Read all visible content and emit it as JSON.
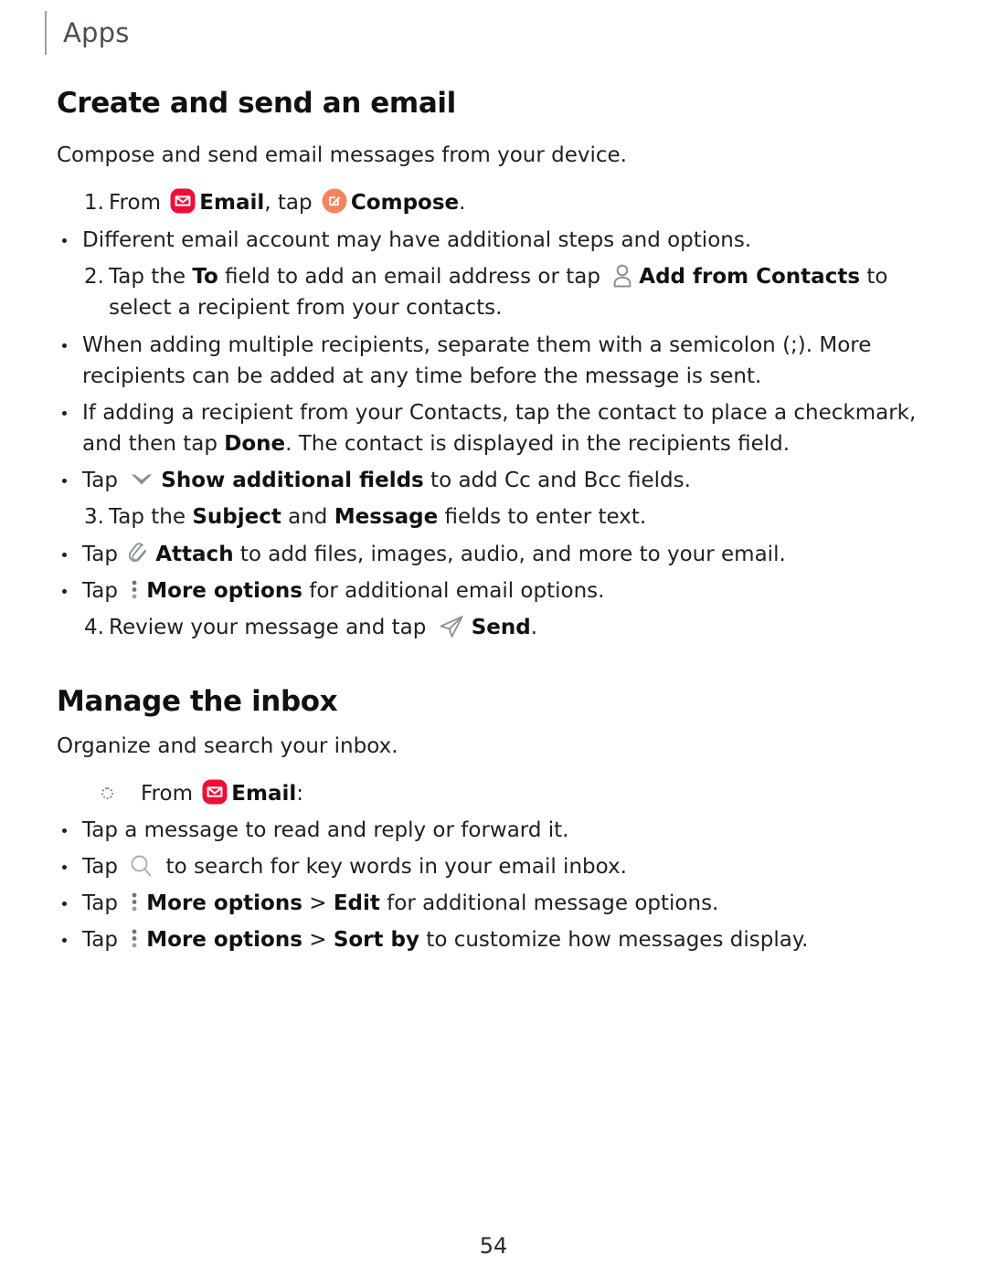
{
  "header": {
    "running_head": "Apps"
  },
  "footer": {
    "page_number": "54"
  },
  "colors": {
    "email_icon_red": "#EE0F38",
    "compose_icon_orange": "#F4845F",
    "gray_icon": "#8A9093",
    "header_rule": "#9AA0A3",
    "body_text": "#1F1F1F"
  },
  "sections": [
    {
      "id": "create-and-send-an-email",
      "title": "Create and send an email",
      "lead": "Compose and send email messages from your device.",
      "steps": [
        {
          "number": "1.",
          "parts": [
            {
              "type": "text",
              "value": "From "
            },
            {
              "type": "icon",
              "name": "email-icon"
            },
            {
              "type": "bold",
              "value": "Email"
            },
            {
              "type": "text",
              "value": ", tap "
            },
            {
              "type": "icon",
              "name": "compose-icon"
            },
            {
              "type": "bold",
              "value": "Compose"
            },
            {
              "type": "text",
              "value": "."
            }
          ],
          "bullets": [
            {
              "parts": [
                {
                  "type": "text",
                  "value": "Different email account may have additional steps and options."
                }
              ]
            }
          ]
        },
        {
          "number": "2.",
          "parts": [
            {
              "type": "text",
              "value": "Tap the "
            },
            {
              "type": "bold",
              "value": "To"
            },
            {
              "type": "text",
              "value": " field to add an email address or tap "
            },
            {
              "type": "icon",
              "name": "contacts-icon"
            },
            {
              "type": "bold",
              "value": "Add from Contacts"
            },
            {
              "type": "text",
              "value": " to select a recipient from your contacts."
            }
          ],
          "bullets": [
            {
              "parts": [
                {
                  "type": "text",
                  "value": "When adding multiple recipients, separate them with a semicolon (;). More recipients can be added at any time before the message is sent."
                }
              ]
            },
            {
              "parts": [
                {
                  "type": "text",
                  "value": "If adding a recipient from your Contacts, tap the contact to place a checkmark, and then tap "
                },
                {
                  "type": "bold",
                  "value": "Done"
                },
                {
                  "type": "text",
                  "value": ". The contact is displayed in the recipients field."
                }
              ]
            },
            {
              "parts": [
                {
                  "type": "text",
                  "value": "Tap "
                },
                {
                  "type": "icon",
                  "name": "chevron-down-icon"
                },
                {
                  "type": "bold",
                  "value": "Show additional fields"
                },
                {
                  "type": "text",
                  "value": " to add Cc and Bcc fields."
                }
              ]
            }
          ]
        },
        {
          "number": "3.",
          "parts": [
            {
              "type": "text",
              "value": "Tap the "
            },
            {
              "type": "bold",
              "value": "Subject"
            },
            {
              "type": "text",
              "value": " and "
            },
            {
              "type": "bold",
              "value": "Message"
            },
            {
              "type": "text",
              "value": " fields to enter text."
            }
          ],
          "bullets": [
            {
              "parts": [
                {
                  "type": "text",
                  "value": "Tap "
                },
                {
                  "type": "icon",
                  "name": "attach-icon"
                },
                {
                  "type": "bold",
                  "value": "Attach"
                },
                {
                  "type": "text",
                  "value": " to add files, images, audio, and more to your email."
                }
              ]
            },
            {
              "parts": [
                {
                  "type": "text",
                  "value": "Tap "
                },
                {
                  "type": "icon",
                  "name": "more-options-icon"
                },
                {
                  "type": "bold",
                  "value": "More options"
                },
                {
                  "type": "text",
                  "value": " for additional email options."
                }
              ]
            }
          ]
        },
        {
          "number": "4.",
          "parts": [
            {
              "type": "text",
              "value": "Review your message and tap "
            },
            {
              "type": "icon",
              "name": "send-icon"
            },
            {
              "type": "bold",
              "value": "Send"
            },
            {
              "type": "text",
              "value": "."
            }
          ],
          "bullets": []
        }
      ]
    },
    {
      "id": "manage-the-inbox",
      "title": "Manage the inbox",
      "lead": "Organize and search your inbox.",
      "dotted_item": {
        "parts": [
          {
            "type": "text",
            "value": "From "
          },
          {
            "type": "icon",
            "name": "email-icon"
          },
          {
            "type": "bold",
            "value": "Email"
          },
          {
            "type": "text",
            "value": ":"
          }
        ]
      },
      "bullets": [
        {
          "parts": [
            {
              "type": "text",
              "value": "Tap a message to read and reply or forward it."
            }
          ]
        },
        {
          "parts": [
            {
              "type": "text",
              "value": "Tap "
            },
            {
              "type": "icon",
              "name": "search-icon"
            },
            {
              "type": "text",
              "value": " to search for key words in your email inbox."
            }
          ]
        },
        {
          "parts": [
            {
              "type": "text",
              "value": "Tap "
            },
            {
              "type": "icon",
              "name": "more-options-icon"
            },
            {
              "type": "bold",
              "value": "More options"
            },
            {
              "type": "text",
              "value": " > "
            },
            {
              "type": "bold",
              "value": "Edit"
            },
            {
              "type": "text",
              "value": " for additional message options."
            }
          ]
        },
        {
          "parts": [
            {
              "type": "text",
              "value": "Tap "
            },
            {
              "type": "icon",
              "name": "more-options-icon"
            },
            {
              "type": "bold",
              "value": "More options"
            },
            {
              "type": "text",
              "value": " > "
            },
            {
              "type": "bold",
              "value": "Sort by"
            },
            {
              "type": "text",
              "value": " to customize how messages display."
            }
          ]
        }
      ]
    }
  ]
}
